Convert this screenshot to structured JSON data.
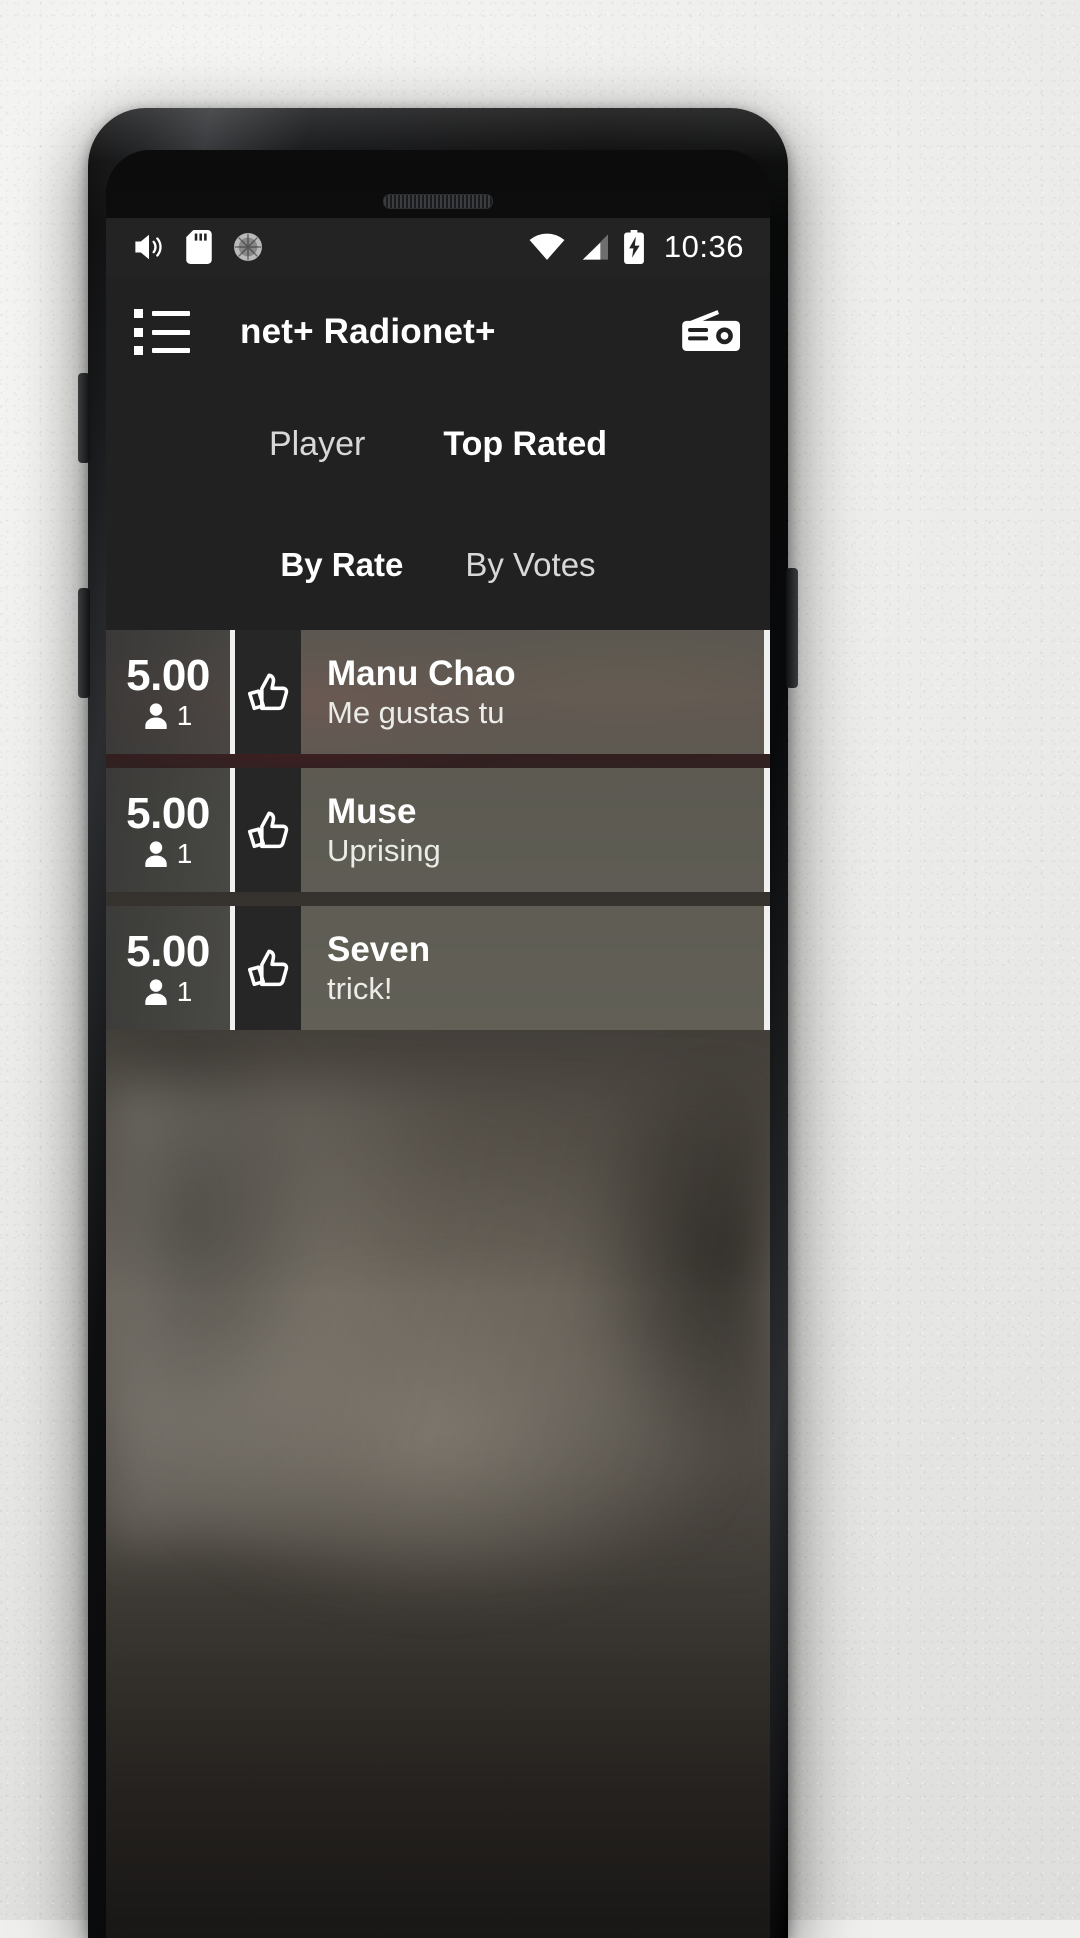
{
  "status_bar": {
    "time": "10:36",
    "left_icons": [
      "volume-icon",
      "sd-card-icon",
      "sync-icon"
    ],
    "right_icons": [
      "wifi-icon",
      "signal-icon",
      "battery-charging-icon"
    ]
  },
  "app_bar": {
    "menu_icon": "list-menu-icon",
    "title": "net+ Radionet+",
    "action_icon": "radio-icon"
  },
  "tabs_primary": [
    {
      "label": "Player",
      "active": false
    },
    {
      "label": "Top Rated",
      "active": true
    }
  ],
  "tabs_secondary": [
    {
      "label": "By Rate",
      "active": true
    },
    {
      "label": "By Votes",
      "active": false
    }
  ],
  "list": {
    "rows": [
      {
        "rating": "5.00",
        "votes": "1",
        "votes_icon": "person-icon",
        "thumb_icon": "thumbs-up-icon",
        "artist": "Manu Chao",
        "title": "Me gustas tu"
      },
      {
        "rating": "5.00",
        "votes": "1",
        "votes_icon": "person-icon",
        "thumb_icon": "thumbs-up-icon",
        "artist": "Muse",
        "title": "Uprising"
      },
      {
        "rating": "5.00",
        "votes": "1",
        "votes_icon": "person-icon",
        "thumb_icon": "thumbs-up-icon",
        "artist": "Seven",
        "title": "trick!"
      }
    ]
  },
  "colors": {
    "app_bar_bg": "#212121",
    "status_bar_bg": "#232323",
    "accent_text": "#ffffff",
    "row_info_bg": "#68675d",
    "row_rate_bg": "#4a4a46",
    "thumb_bg": "#262626",
    "divider": "#f0f0ee"
  }
}
